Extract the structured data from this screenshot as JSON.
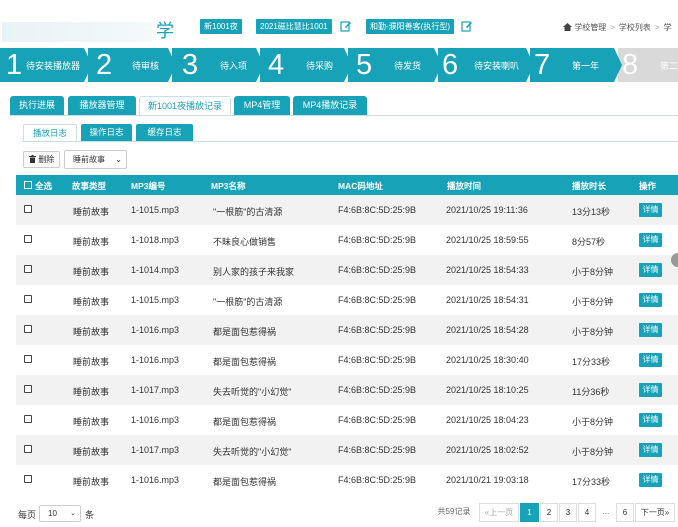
{
  "header": {
    "school_name": "学",
    "tags": [
      "新1001夜",
      "2021磁比慧比1001",
      "和勤-濮阳善客(执行型)"
    ],
    "breadcrumb": [
      "学校管理",
      "学校列表",
      "学"
    ]
  },
  "steps": [
    {
      "num": "1",
      "label": "待安装播放器"
    },
    {
      "num": "2",
      "label": "待审核"
    },
    {
      "num": "3",
      "label": "待入项"
    },
    {
      "num": "4",
      "label": "待采购"
    },
    {
      "num": "5",
      "label": "待发货"
    },
    {
      "num": "6",
      "label": "待安装喇叭"
    },
    {
      "num": "7",
      "label": "第一年"
    },
    {
      "num": "8",
      "label": "第二"
    }
  ],
  "main_tabs": [
    "执行进展",
    "播放器管理",
    "新1001夜播放记录",
    "MP4管理",
    "MP4播放记录"
  ],
  "sub_tabs": [
    "播放日志",
    "操作日志",
    "缓存日志"
  ],
  "toolbar": {
    "delete_label": "删除",
    "type_filter": "睡前故事",
    "type_caret": "⌄"
  },
  "table": {
    "headers": [
      "全选",
      "故事类型",
      "MP3编号",
      "MP3名称",
      "MAC码地址",
      "播放时间",
      "播放时长",
      "操作"
    ],
    "rows": [
      {
        "type": "睡前故事",
        "id": "1-1015.mp3",
        "name": "\"一根筋\"的古清源",
        "mac": "F4:6B:8C:5D:25:9B",
        "time": "2021/10/25 19:11:36",
        "duration": "13分13秒",
        "action": "详情"
      },
      {
        "type": "睡前故事",
        "id": "1-1018.mp3",
        "name": "不昧良心做销售",
        "mac": "F4:6B:8C:5D:25:9B",
        "time": "2021/10/25 18:59:55",
        "duration": "8分57秒",
        "action": "详情"
      },
      {
        "type": "睡前故事",
        "id": "1-1014.mp3",
        "name": "别人家的孩子来我家",
        "mac": "F4:6B:8C:5D:25:9B",
        "time": "2021/10/25 18:54:33",
        "duration": "小于8分钟",
        "action": "详情"
      },
      {
        "type": "睡前故事",
        "id": "1-1015.mp3",
        "name": "\"一根筋\"的古清源",
        "mac": "F4:6B:8C:5D:25:9B",
        "time": "2021/10/25 18:54:31",
        "duration": "小于8分钟",
        "action": "详情"
      },
      {
        "type": "睡前故事",
        "id": "1-1016.mp3",
        "name": "都是面包惹得祸",
        "mac": "F4:6B:8C:5D:25:9B",
        "time": "2021/10/25 18:54:28",
        "duration": "小于8分钟",
        "action": "详情"
      },
      {
        "type": "睡前故事",
        "id": "1-1016.mp3",
        "name": "都是面包惹得祸",
        "mac": "F4:6B:8C:5D:25:9B",
        "time": "2021/10/25 18:30:40",
        "duration": "17分33秒",
        "action": "详情"
      },
      {
        "type": "睡前故事",
        "id": "1-1017.mp3",
        "name": "失去听觉的\"小幻觉\"",
        "mac": "F4:6B:8C:5D:25:9B",
        "time": "2021/10/25 18:10:25",
        "duration": "11分36秒",
        "action": "详情"
      },
      {
        "type": "睡前故事",
        "id": "1-1016.mp3",
        "name": "都是面包惹得祸",
        "mac": "F4:6B:8C:5D:25:9B",
        "time": "2021/10/25 18:04:23",
        "duration": "小于8分钟",
        "action": "详情"
      },
      {
        "type": "睡前故事",
        "id": "1-1017.mp3",
        "name": "失去听觉的\"小幻觉\"",
        "mac": "F4:6B:8C:5D:25:9B",
        "time": "2021/10/25 18:02:52",
        "duration": "小于8分钟",
        "action": "详情"
      },
      {
        "type": "睡前故事",
        "id": "1-1016.mp3",
        "name": "都是面包惹得祸",
        "mac": "F4:6B:8C:5D:25:9B",
        "time": "2021/10/21 19:03:18",
        "duration": "17分33秒",
        "action": "详情"
      }
    ]
  },
  "footer": {
    "per_page_prefix": "每页",
    "per_page_value": "10",
    "per_page_suffix": "条",
    "total": "共59记录",
    "prev": "«上一页",
    "pages": [
      "1",
      "2",
      "3",
      "4",
      "...",
      "6"
    ],
    "next": "下一页»",
    "current_page": "1"
  },
  "colors": {
    "accent": "#17a2b8",
    "step_inactive": "#d9d9d9",
    "row_alt": "#f2f2f2"
  },
  "icons": [
    "edit-icon",
    "home-icon",
    "trash-icon",
    "checkbox-icon"
  ]
}
